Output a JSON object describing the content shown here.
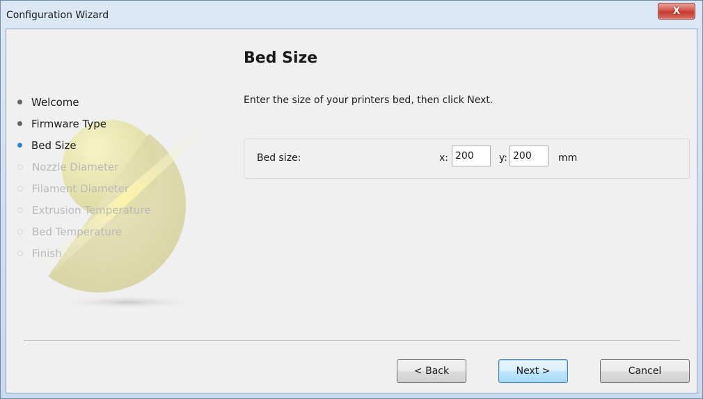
{
  "window": {
    "title": "Configuration Wizard",
    "close_label": "X"
  },
  "sidebar": {
    "steps": [
      {
        "label": "Welcome",
        "state": "done"
      },
      {
        "label": "Firmware Type",
        "state": "done"
      },
      {
        "label": "Bed Size",
        "state": "current"
      },
      {
        "label": "Nozzle Diameter",
        "state": "future"
      },
      {
        "label": "Filament Diameter",
        "state": "future"
      },
      {
        "label": "Extrusion Temperature",
        "state": "future"
      },
      {
        "label": "Bed Temperature",
        "state": "future"
      },
      {
        "label": "Finish",
        "state": "future"
      }
    ]
  },
  "page": {
    "title": "Bed Size",
    "instruction": "Enter the size of your printers bed, then click Next."
  },
  "bed": {
    "label": "Bed size:",
    "x_label": "x:",
    "x_value": "200",
    "y_label": "y:",
    "y_value": "200",
    "unit": "mm"
  },
  "buttons": {
    "back": "< Back",
    "next": "Next >",
    "cancel": "Cancel"
  },
  "colors": {
    "current_step_bullet": "#2b86d6",
    "done_step_bullet": "#666666",
    "future_step_text": "#b9b9b9"
  }
}
